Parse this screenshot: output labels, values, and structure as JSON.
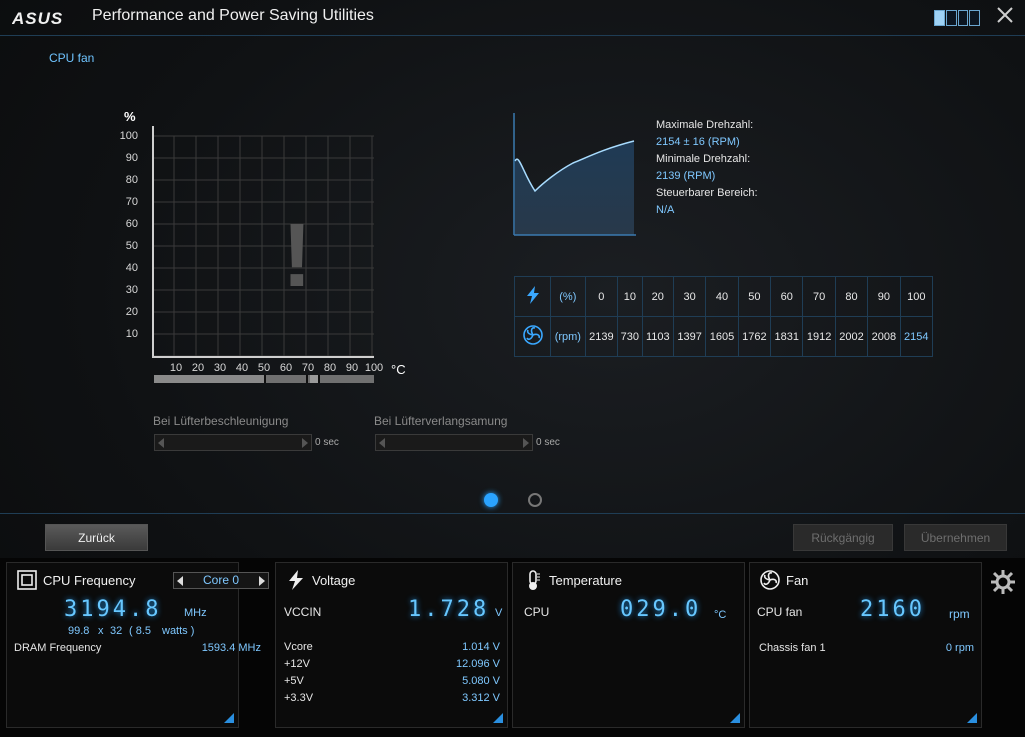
{
  "app": {
    "title": "Performance and Power Saving Utilities",
    "brand": "ASUS"
  },
  "colors": {
    "accent": "#2aa3ff",
    "text_blue": "#7fc8ff",
    "digital": "#67c7ff",
    "border": "#1f3d55"
  },
  "page": {
    "section_title": "CPU fan"
  },
  "fan_curve": {
    "y_unit": "%",
    "y_ticks": [
      "100",
      "90",
      "80",
      "70",
      "60",
      "50",
      "40",
      "30",
      "20",
      "10"
    ],
    "x_ticks": [
      "10",
      "20",
      "30",
      "40",
      "50",
      "60",
      "70",
      "80",
      "90",
      "100"
    ],
    "x_unit": "°C",
    "warning_glyph": "!"
  },
  "rpm_info": {
    "max_label": "Maximale Drehzahl:",
    "max_value": "2154 ± 16 (RPM)",
    "min_label": "Minimale Drehzahl:",
    "min_value": "2139 (RPM)",
    "range_label": "Steuerbarer Bereich:",
    "range_value": "N/A"
  },
  "fan_table": {
    "percent_unit": "(%)",
    "rpm_unit": "(rpm)",
    "percents": [
      "0",
      "10",
      "20",
      "30",
      "40",
      "50",
      "60",
      "70",
      "80",
      "90",
      "100"
    ],
    "rpms": [
      "2139",
      "730",
      "1103",
      "1397",
      "1605",
      "1762",
      "1831",
      "1912",
      "2002",
      "2008",
      "2154"
    ]
  },
  "delays": {
    "accel_label": "Bei Lüfterbeschleunigung",
    "accel_value": "0 sec",
    "decel_label": "Bei Lüfterverlangsamung",
    "decel_value": "0 sec"
  },
  "pager": {
    "current": 1,
    "total": 2
  },
  "buttons": {
    "back": "Zurück",
    "undo": "Rückgängig",
    "apply": "Übernehmen"
  },
  "cpu_panel": {
    "title": "CPU Frequency",
    "core_selector": "Core 0",
    "frequency": "3194.8",
    "frequency_unit": "MHz",
    "bclk": "99.8",
    "x": "x",
    "multiplier": "32",
    "power": "( 8.5",
    "power_unit": "watts )",
    "dram_label": "DRAM Frequency",
    "dram_value": "1593.4 MHz"
  },
  "voltage_panel": {
    "title": "Voltage",
    "main_label": "VCCIN",
    "main_value": "1.728",
    "main_unit": "V",
    "rows": [
      {
        "label": "Vcore",
        "value": "1.014  V"
      },
      {
        "label": "+12V",
        "value": "12.096  V"
      },
      {
        "label": "+5V",
        "value": "5.080  V"
      },
      {
        "label": "+3.3V",
        "value": "3.312  V"
      }
    ]
  },
  "temp_panel": {
    "title": "Temperature",
    "main_label": "CPU",
    "main_value": "029.0",
    "main_unit": "°C"
  },
  "fan_panel": {
    "title": "Fan",
    "main_label": "CPU fan",
    "main_value": "2160",
    "main_unit": "rpm",
    "rows": [
      {
        "label": "Chassis fan 1",
        "value": "0  rpm"
      }
    ]
  }
}
